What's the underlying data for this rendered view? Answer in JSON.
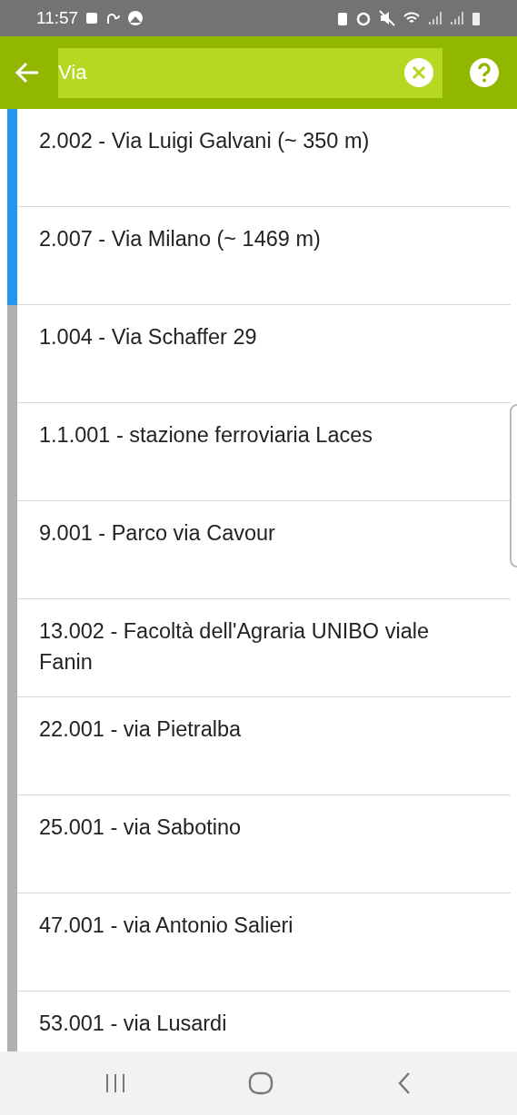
{
  "status_bar": {
    "time": "11:57"
  },
  "search": {
    "value": "Via"
  },
  "results": [
    {
      "label": "2.002 - Via Luigi Galvani (~ 350 m)",
      "color": "#2196f3"
    },
    {
      "label": "2.007 - Via Milano (~ 1469 m)",
      "color": "#2196f3"
    },
    {
      "label": "1.004 - Via Schaffer 29",
      "color": "#b0b0b0"
    },
    {
      "label": "1.1.001 - stazione ferroviaria Laces",
      "color": "#b0b0b0"
    },
    {
      "label": "9.001 - Parco via Cavour",
      "color": "#b0b0b0"
    },
    {
      "label": "13.002 - Facoltà dell'Agraria UNIBO viale Fanin",
      "color": "#b0b0b0"
    },
    {
      "label": "22.001 - via Pietralba",
      "color": "#b0b0b0"
    },
    {
      "label": "25.001 - via Sabotino",
      "color": "#b0b0b0"
    },
    {
      "label": "47.001 - via Antonio Salieri",
      "color": "#b0b0b0"
    },
    {
      "label": "53.001 - via Lusardi",
      "color": "#b0b0b0"
    }
  ]
}
